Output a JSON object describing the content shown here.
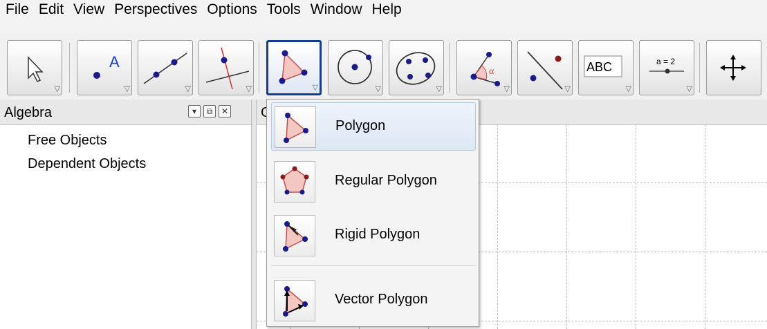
{
  "menubar": [
    "File",
    "Edit",
    "View",
    "Perspectives",
    "Options",
    "Tools",
    "Window",
    "Help"
  ],
  "toolbar": {
    "tools": [
      {
        "name": "move-tool",
        "icon": "arrow-cursor-icon",
        "selected": false
      },
      {
        "name": "point-tool",
        "icon": "point-A-icon",
        "selected": false
      },
      {
        "name": "line-tool",
        "icon": "line-through-two-points-icon",
        "selected": false
      },
      {
        "name": "perpendicular-line-tool",
        "icon": "perpendicular-line-icon",
        "selected": false
      },
      {
        "name": "polygon-tool",
        "icon": "polygon-icon",
        "selected": true
      },
      {
        "name": "circle-tool",
        "icon": "circle-center-point-icon",
        "selected": false
      },
      {
        "name": "conic-tool",
        "icon": "conic-five-points-icon",
        "selected": false
      },
      {
        "name": "angle-tool",
        "icon": "angle-alpha-icon",
        "selected": false
      },
      {
        "name": "reflect-tool",
        "icon": "reflect-about-line-icon",
        "selected": false
      },
      {
        "name": "text-tool",
        "icon": "text-ABC-icon",
        "selected": false,
        "label": "ABC"
      },
      {
        "name": "slider-tool",
        "icon": "slider-icon",
        "selected": false,
        "label": "a = 2"
      },
      {
        "name": "move-graphics-tool",
        "icon": "move-cross-arrows-icon",
        "selected": false
      }
    ]
  },
  "algebra": {
    "title": "Algebra",
    "items": [
      "Free Objects",
      "Dependent Objects"
    ]
  },
  "graphics": {
    "title": "G"
  },
  "dropdown": {
    "items": [
      {
        "label": "Polygon",
        "icon": "polygon-icon",
        "highlighted": true
      },
      {
        "label": "Regular Polygon",
        "icon": "regular-polygon-icon",
        "highlighted": false
      },
      {
        "label": "Rigid Polygon",
        "icon": "rigid-polygon-icon",
        "highlighted": false
      },
      {
        "label": "Vector Polygon",
        "icon": "vector-polygon-icon",
        "highlighted": false
      }
    ]
  },
  "colors": {
    "selected_border": "#153d8f",
    "point_blue": "#1a1a8c",
    "point_red": "#8b1a1a",
    "polygon_fill": "#f4c7c3",
    "polygon_edge": "#c0504d"
  }
}
